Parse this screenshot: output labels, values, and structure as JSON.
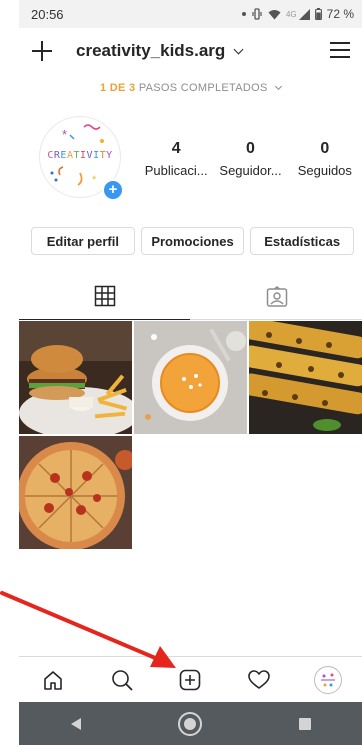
{
  "status_bar": {
    "time": "20:56",
    "signal_label": "4G",
    "battery": "72 %"
  },
  "header": {
    "account_name": "creativity_kids.arg"
  },
  "steps": {
    "prefix": "1 DE 3",
    "suffix": "PASOS COMPLETADOS"
  },
  "profile": {
    "avatar_text": "CREATIVITY",
    "stats": [
      {
        "value": "4",
        "label": "Publicaci..."
      },
      {
        "value": "0",
        "label": "Seguidor..."
      },
      {
        "value": "0",
        "label": "Seguidos"
      }
    ]
  },
  "actions": {
    "edit": "Editar perfil",
    "promotions": "Promociones",
    "statistics": "Estadísticas"
  },
  "tabs": [
    {
      "icon": "grid-icon",
      "active": true
    },
    {
      "icon": "tagged-icon",
      "active": false
    }
  ],
  "posts": [
    {
      "subject": "burger-and-fries"
    },
    {
      "subject": "pumpkin-soup"
    },
    {
      "subject": "grilled-corn"
    },
    {
      "subject": "pizza"
    }
  ],
  "bottom_nav": [
    "home-icon",
    "search-icon",
    "new-post-icon",
    "activity-icon",
    "profile-avatar"
  ],
  "android_nav": [
    "back-icon",
    "home-circle-icon",
    "recents-icon"
  ],
  "colors": {
    "accent": "#e8a33a",
    "blue": "#3897f0",
    "arrow": "#e5261c"
  }
}
